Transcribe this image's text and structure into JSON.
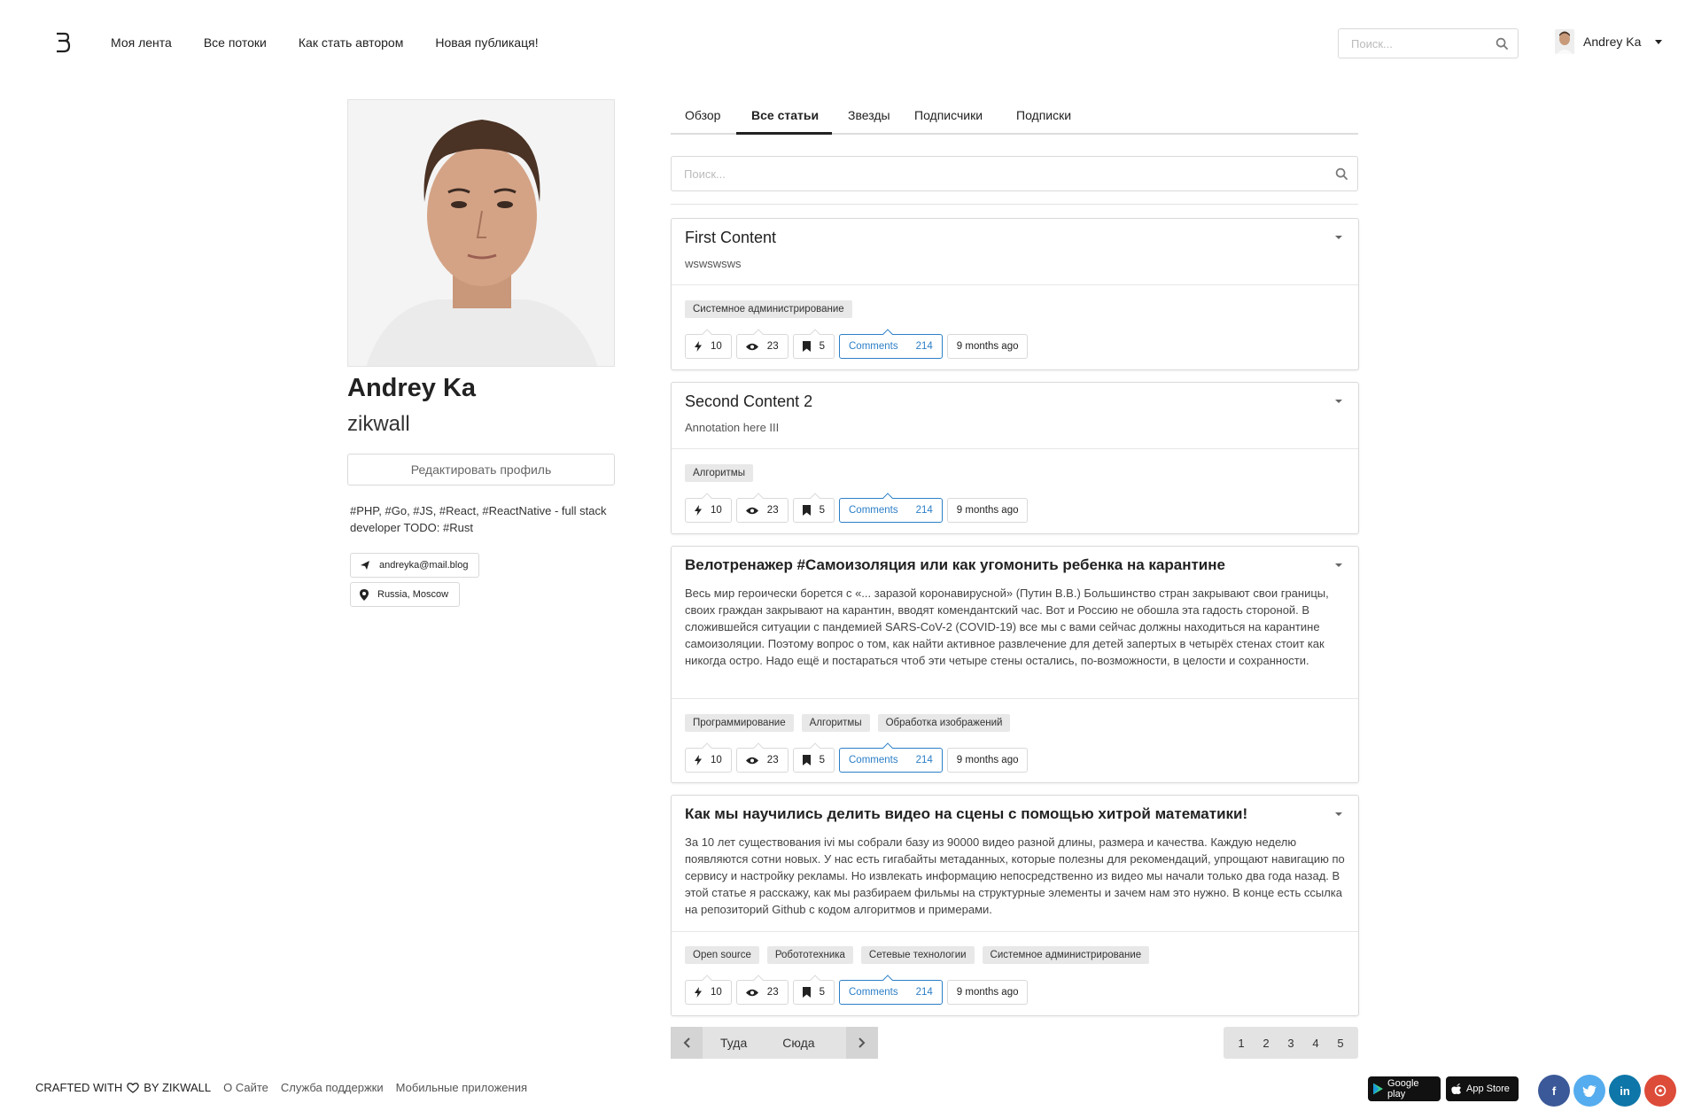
{
  "nav": {
    "logo_icon": "logo-icon",
    "links": [
      "Моя лента",
      "Все потоки",
      "Как стать автором",
      "Новая публикаця!"
    ],
    "search_placeholder": "Поиск...",
    "user_name": "Andrey Ka"
  },
  "profile": {
    "name": "Andrey Ka",
    "login": "zikwall",
    "edit_label": "Редактировать профиль",
    "bio": "#PHP, #Go, #JS, #React, #ReactNative - full stack developer TODO: #Rust",
    "email": "andreyka@mail.blog",
    "location": "Russia, Moscow"
  },
  "tabs": [
    "Обзор",
    "Все статьи",
    "Звезды",
    "Подписчики",
    "Подписки"
  ],
  "active_tab": "Все статьи",
  "content_search_placeholder": "Поиск...",
  "comments_label": "Comments",
  "cards": [
    {
      "title": "First Content",
      "text": "wswswsws",
      "tags": [
        "Системное администрирование"
      ],
      "likes": "10",
      "views": "23",
      "bookmarks": "5",
      "comments": "214",
      "time": "9 months ago"
    },
    {
      "title": "Second Content 2",
      "text": "Annotation here III",
      "tags": [
        "Алгоритмы"
      ],
      "likes": "10",
      "views": "23",
      "bookmarks": "5",
      "comments": "214",
      "time": "9 months ago"
    },
    {
      "title": "Велотренажер #Самоизоляция или как угомонить ребенка на карантине",
      "text": "Весь мир героически борется с «... заразой коронавирусной» (Путин В.В.) Большинство стран закрывают свои границы, своих граждан закрывают на карантин, вводят комендантский час. Вот и Россию не обошла эта гадость стороной. В сложившейся ситуации с пандемией SARS-CoV-2 (COVID-19) все мы с вами сейчас должны находиться на карантине самоизоляции. Поэтому вопрос о том, как найти активное развлечение для детей запертых в четырёх стенах стоит как никогда остро. Надо ещё и постараться чтоб эти четыре стены остались, по-возможности, в целости и сохранности.",
      "tags": [
        "Программирование",
        "Алгоритмы",
        "Обработка изображений"
      ],
      "likes": "10",
      "views": "23",
      "bookmarks": "5",
      "comments": "214",
      "time": "9 months ago"
    },
    {
      "title": "Как мы научились делить видео на сцены с помощью хитрой математики!",
      "text": "За 10 лет существования ivi мы собрали базу из 90000 видео разной длины, размера и качества. Каждую неделю появляются сотни новых. У нас есть гигабайты метаданных, которые полезны для рекомендаций, упрощают навигацию по сервису и настройку рекламы. Но извлекать информацию непосредственно из видео мы начали только два года назад. В этой статье я расскажу, как мы разбираем фильмы на структурные элементы и зачем нам это нужно. В конце есть ссылка на репозиторий Github с кодом алгоритмов и примерами.",
      "tags": [
        "Open source",
        "Робототехника",
        "Сетевые технологии",
        "Системное администрирование"
      ],
      "likes": "10",
      "views": "23",
      "bookmarks": "5",
      "comments": "214",
      "time": "9 months ago"
    }
  ],
  "pager": {
    "prev": "Туда",
    "next": "Сюда",
    "pages": [
      "1",
      "2",
      "3",
      "4",
      "5"
    ]
  },
  "footer": {
    "crafted_prefix": "CRAFTED WITH",
    "crafted_suffix": "BY ZIKWALL",
    "links": [
      "О Сайте",
      "Служба поддержки",
      "Мобильные приложения"
    ],
    "google_play": "Google play",
    "app_store": "App Store",
    "social": [
      "facebook-icon",
      "twitter-icon",
      "linkedin-icon",
      "other-social-icon"
    ]
  },
  "colors": {
    "accent": "#2c7fc7",
    "facebook": "#3b5998",
    "twitter": "#55acee",
    "linkedin": "#0e76a8",
    "red": "#dd4b39"
  }
}
